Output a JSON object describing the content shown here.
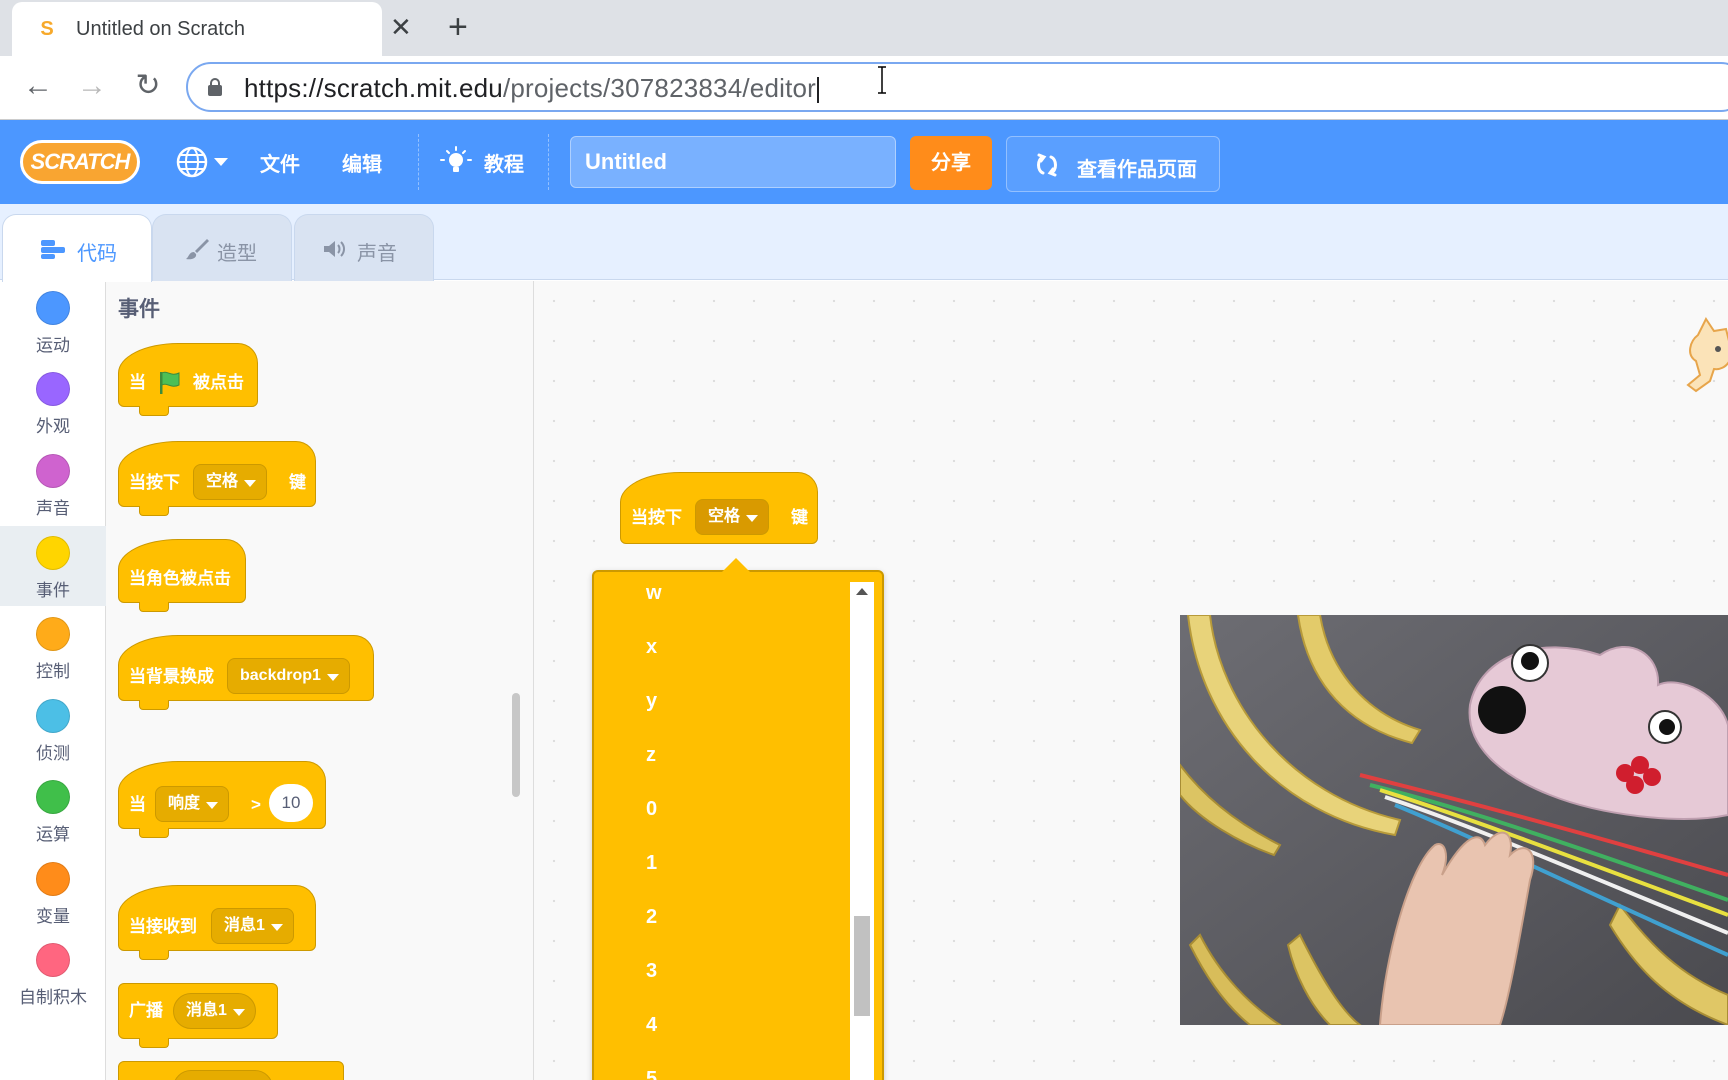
{
  "browser": {
    "tab_title": "Untitled on Scratch",
    "close_glyph": "✕",
    "new_tab_glyph": "+",
    "url_host": "https://scratch.mit.edu",
    "url_rest": "/projects/307823834/editor",
    "back_glyph": "←",
    "forward_glyph": "→",
    "reload_glyph": "↻"
  },
  "menubar": {
    "logo_text": "SCRATCH",
    "file": "文件",
    "edit": "编辑",
    "tutorials": "教程",
    "project_title": "Untitled",
    "share": "分享",
    "see_project_page": "查看作品页面",
    "accent": "#4c97ff",
    "share_color": "#ff8c1a"
  },
  "editor_tabs": [
    {
      "label": "代码",
      "icon": "code-icon",
      "active": true
    },
    {
      "label": "造型",
      "icon": "brush-icon",
      "active": false
    },
    {
      "label": "声音",
      "icon": "speaker-icon",
      "active": false
    }
  ],
  "categories": [
    {
      "label": "运动",
      "color": "#4c97ff"
    },
    {
      "label": "外观",
      "color": "#9966ff"
    },
    {
      "label": "声音",
      "color": "#cf63cf"
    },
    {
      "label": "事件",
      "color": "#ffd500",
      "selected": true
    },
    {
      "label": "控制",
      "color": "#ffab19"
    },
    {
      "label": "侦测",
      "color": "#4cbfe6"
    },
    {
      "label": "运算",
      "color": "#40bf4a"
    },
    {
      "label": "变量",
      "color": "#ff8c1a"
    },
    {
      "label": "自制积木",
      "color": "#ff6680"
    }
  ],
  "palette": {
    "title": "事件",
    "blocks": {
      "flag_pre": "当",
      "flag_post": "被点击",
      "key_pre": "当按下",
      "key_value": "空格",
      "key_post": "键",
      "sprite_clicked": "当角色被点击",
      "backdrop_pre": "当背景换成",
      "backdrop_value": "backdrop1",
      "loudness_pre": "当",
      "loudness_value": "响度",
      "loudness_op": ">",
      "loudness_num": "10",
      "receive_pre": "当接收到",
      "receive_value": "消息1",
      "broadcast_pre": "广播",
      "broadcast_value": "消息1"
    }
  },
  "workspace": {
    "block": {
      "pre": "当按下",
      "value": "空格",
      "post": "键"
    },
    "dropdown_items": [
      "w",
      "x",
      "y",
      "z",
      "0",
      "1",
      "2",
      "3",
      "4",
      "5"
    ]
  }
}
